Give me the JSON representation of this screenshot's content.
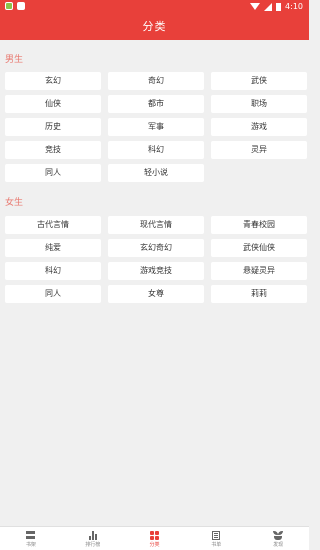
{
  "status_bar": {
    "time": "4:10",
    "icons": [
      "app-notification-icon",
      "app-icon",
      "wifi-icon",
      "signal-icon",
      "battery-icon"
    ]
  },
  "app_bar": {
    "title": "分类"
  },
  "male": {
    "title": "男生",
    "categories": [
      "玄幻",
      "奇幻",
      "武侠",
      "仙侠",
      "都市",
      "职场",
      "历史",
      "军事",
      "游戏",
      "竞技",
      "科幻",
      "灵异",
      "同人",
      "轻小说"
    ]
  },
  "female": {
    "title": "女生",
    "categories": [
      "古代言情",
      "现代言情",
      "青春校园",
      "纯爱",
      "玄幻奇幻",
      "武侠仙侠",
      "科幻",
      "游戏竞技",
      "悬疑灵异",
      "同人",
      "女尊",
      "莉莉"
    ]
  },
  "bottom_nav": {
    "items": [
      {
        "label": "书架",
        "icon": "bookshelf-icon"
      },
      {
        "label": "排行榜",
        "icon": "ranking-icon"
      },
      {
        "label": "分类",
        "icon": "category-icon",
        "active": true
      },
      {
        "label": "书单",
        "icon": "booklist-icon"
      },
      {
        "label": "发现",
        "icon": "discover-icon"
      }
    ]
  },
  "colors": {
    "primary": "#e8403a",
    "section_title": "#e8786f",
    "background": "#f0f0f0"
  }
}
